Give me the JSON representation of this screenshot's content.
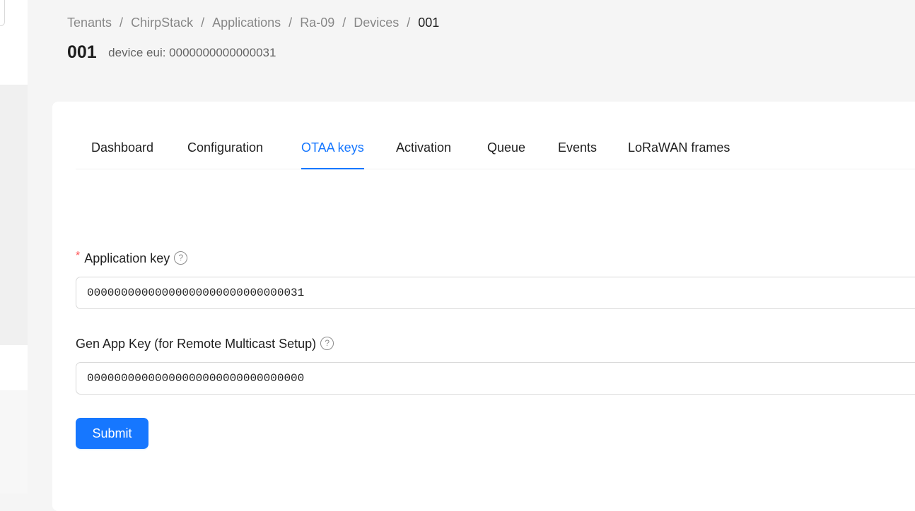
{
  "breadcrumb": {
    "items": [
      "Tenants",
      "ChirpStack",
      "Applications",
      "Ra-09",
      "Devices",
      "001"
    ],
    "separator": "/"
  },
  "header": {
    "title": "001",
    "subtitle": "device eui: 0000000000000031"
  },
  "tabs": [
    {
      "label": "Dashboard",
      "active": false
    },
    {
      "label": "Configuration",
      "active": false
    },
    {
      "label": "OTAA keys",
      "active": true
    },
    {
      "label": "Activation",
      "active": false
    },
    {
      "label": "Queue",
      "active": false
    },
    {
      "label": "Events",
      "active": false
    },
    {
      "label": "LoRaWAN frames",
      "active": false
    }
  ],
  "form": {
    "app_key": {
      "required_mark": "*",
      "label": "Application key",
      "help_icon": "?",
      "value": "00000000000000000000000000000031"
    },
    "gen_app_key": {
      "label": "Gen App Key (for Remote Multicast Setup)",
      "help_icon": "?",
      "value": "00000000000000000000000000000000"
    },
    "submit_label": "Submit"
  },
  "colors": {
    "accent": "#1677ff",
    "required": "#ff4d4f",
    "background": "#f5f5f5"
  }
}
